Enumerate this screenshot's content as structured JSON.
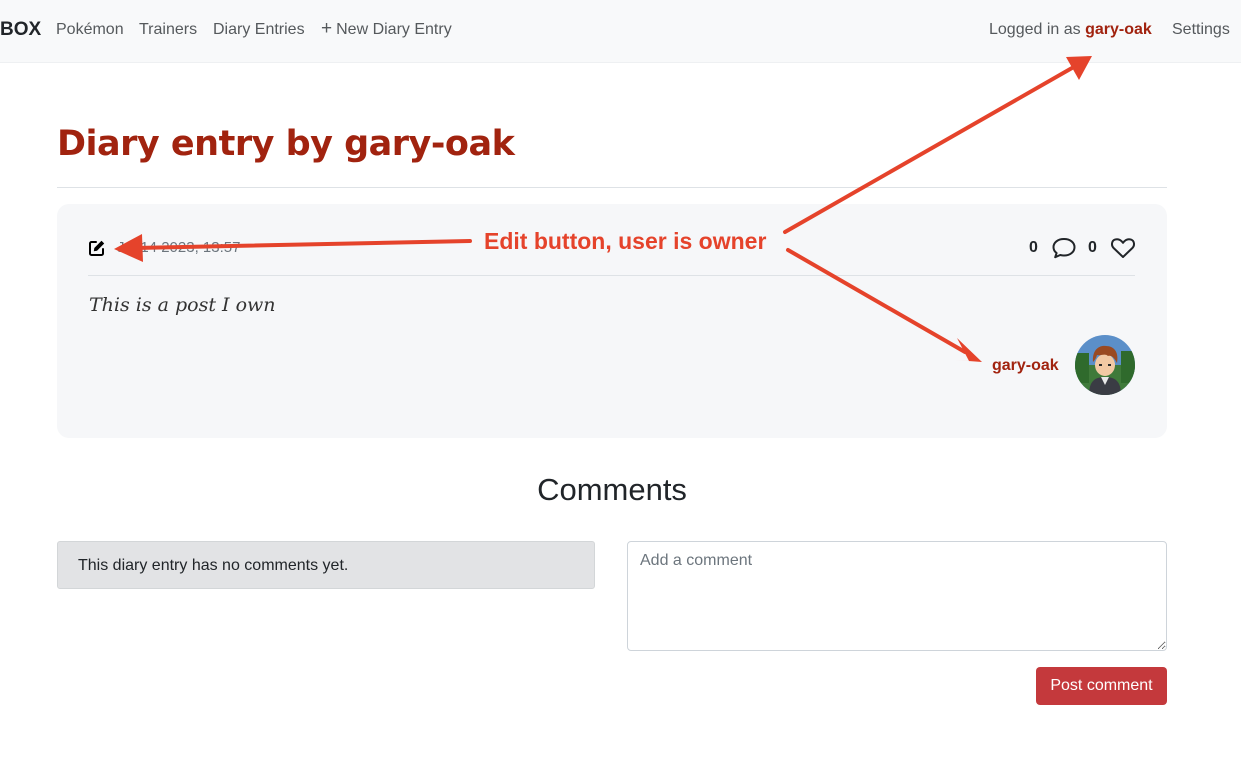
{
  "navbar": {
    "brand": "BOX",
    "links": [
      {
        "label": "Pokémon"
      },
      {
        "label": "Trainers"
      },
      {
        "label": "Diary Entries"
      },
      {
        "label": "New Diary Entry",
        "icon": "plus-icon"
      }
    ],
    "logged_in_prefix": "Logged in as",
    "logged_in_user": "gary-oak",
    "settings_label": "Settings"
  },
  "page": {
    "title": "Diary entry by gary-oak"
  },
  "entry": {
    "date": "Jul 14 2023, 13:57",
    "comment_count": "0",
    "like_count": "0",
    "body": "This is a post I own",
    "author": "gary-oak"
  },
  "comments": {
    "title": "Comments",
    "empty_message": "This diary entry has no comments yet.",
    "input_placeholder": "Add a comment",
    "submit_label": "Post comment"
  },
  "annotation": {
    "text": "Edit button, user is owner",
    "color": "#e5432b"
  },
  "colors": {
    "brand_red": "#a1230f",
    "button_red": "#c4393c",
    "navbar_bg": "#f8f9fa",
    "card_bg": "#f6f7f9"
  }
}
